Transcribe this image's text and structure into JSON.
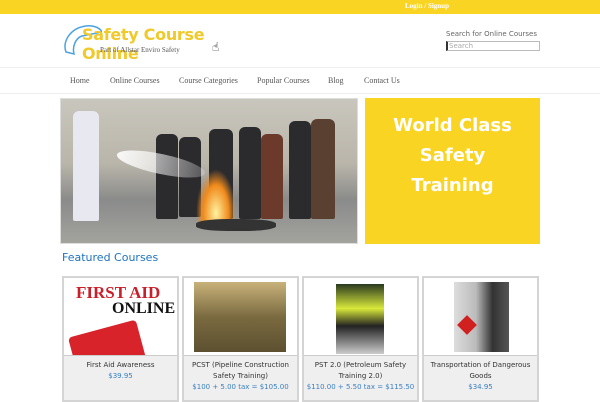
{
  "topbar": {
    "login": "Login / Signup"
  },
  "logo": {
    "title": "Safety Course Online",
    "subtitle": "Part of Allstar Enviro Safety"
  },
  "search": {
    "label": "Search for Online Courses",
    "placeholder": "Search"
  },
  "nav": [
    "Home",
    "Online Courses",
    "Course Categories",
    "Popular Courses",
    "Blog",
    "Contact Us"
  ],
  "promo": {
    "lines": [
      "World Class",
      "Safety",
      "Training"
    ]
  },
  "featured": {
    "title": "Featured Courses",
    "courses": [
      {
        "title": "First Aid Awareness",
        "price": "$39.95",
        "image_text": [
          "FIRST AID",
          "ONLINE"
        ]
      },
      {
        "title": "PCST (Pipeline Construction Safety Training)",
        "price": "$100 + 5.00 tax = $105.00"
      },
      {
        "title": "PST 2.0 (Petroleum Safety Training 2.0)",
        "price": "$110.00 + 5.50 tax = $115.50"
      },
      {
        "title": "Transportation of Dangerous Goods",
        "price": "$34.95"
      }
    ]
  },
  "colors": {
    "brand": "#f9d423",
    "link": "#1e73be"
  }
}
